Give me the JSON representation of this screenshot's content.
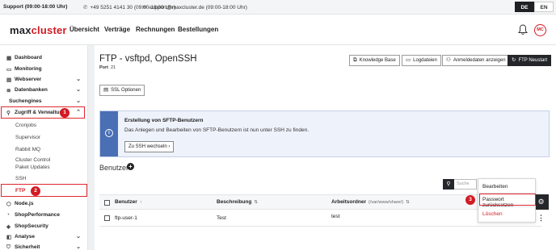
{
  "topbar": {
    "hours": "Support (09:00-18:00 Uhr)",
    "phone": "+49 5251 4141 30 (09:00-18:00 Uhr)",
    "email": "support@maxcluster.de (09:00-18:00 Uhr)",
    "languages": [
      "DE",
      "EN"
    ]
  },
  "header": {
    "logo_part1": "max",
    "logo_part2": "cluster",
    "nav": [
      "Übersicht",
      "Verträge",
      "Rechnungen",
      "Bestellungen"
    ],
    "avatar": "MC"
  },
  "sidebar": {
    "items": [
      {
        "label": "Dashboard",
        "icon": "grid-icon"
      },
      {
        "label": "Monitoring",
        "icon": "monitor-icon"
      },
      {
        "label": "Webserver",
        "icon": "server-icon",
        "chevron": "down"
      },
      {
        "label": "Datenbanken",
        "icon": "database-icon",
        "chevron": "down"
      },
      {
        "label": "Suchengines",
        "icon": "search-engine-icon",
        "chevron": "down"
      },
      {
        "label": "Zugriff & Verwaltung",
        "icon": "key-icon",
        "chevron": "up"
      }
    ],
    "subitems": [
      "Cronjobs",
      "Supervisor",
      "Rabbit MQ",
      "Cluster Control",
      "Paket Updates",
      "SSH",
      "FTP"
    ],
    "items_bottom": [
      {
        "label": "Node.js",
        "icon": "node-icon"
      },
      {
        "label": "ShopPerformance",
        "icon": "performance-icon"
      },
      {
        "label": "ShopSecurity",
        "icon": "security-icon"
      },
      {
        "label": "Analyse",
        "icon": "analyse-icon",
        "chevron": "down"
      },
      {
        "label": "Sicherheit",
        "icon": "shield-icon",
        "chevron": "down"
      }
    ]
  },
  "badges": [
    "1",
    "2",
    "3"
  ],
  "main": {
    "title": "FTP - vsftpd, OpenSSH",
    "port_label": "Port",
    "port_value": "21",
    "buttons": [
      "Knowledge Base",
      "Logdateien",
      "Anmeldedaten anzeigen",
      "FTP Neustart"
    ],
    "ssl_button": "SSL Optionen",
    "info": {
      "heading": "Erstellung von SFTP-Benutzern",
      "text": "Das Anlegen und Bearbeiten von SFTP-Benutzern ist nun unter SSH zu finden.",
      "button": "Zu SSH wechseln"
    },
    "users_heading": "Benutzer",
    "search_placeholder": "Suche",
    "columns": {
      "user": "Benutzer",
      "description": "Beschreibung",
      "folder": "Arbeitsordner",
      "folder_hint": "(/var/www/share/)"
    },
    "rows": [
      {
        "user": "ftp-user-1",
        "description": "Test",
        "folder": "test"
      }
    ],
    "menu": [
      "Bearbeiten",
      "Passwort zurücksetzen",
      "Löschen"
    ]
  },
  "colors": {
    "accent": "#d21b24",
    "dark": "#24262a",
    "info": "#4a6fb5"
  }
}
